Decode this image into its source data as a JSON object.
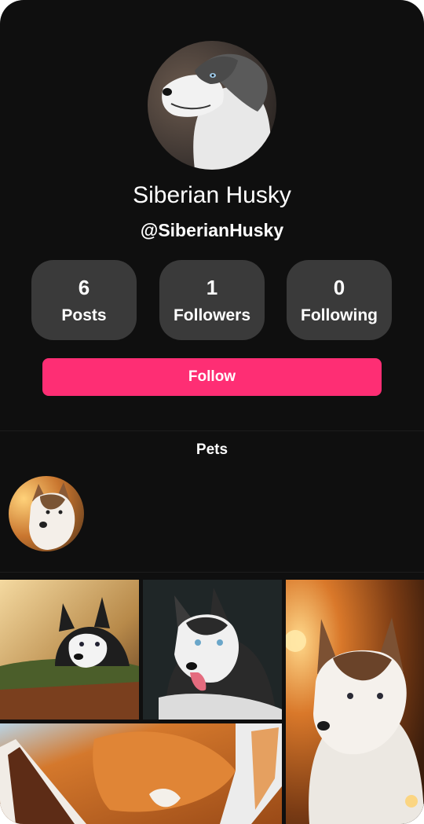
{
  "profile": {
    "name": "Siberian Husky",
    "handle": "@SiberianHusky",
    "avatar_icon": "husky-profile-photo"
  },
  "stats": [
    {
      "value": "6",
      "label": "Posts"
    },
    {
      "value": "1",
      "label": "Followers"
    },
    {
      "value": "0",
      "label": "Following"
    }
  ],
  "follow_button": {
    "label": "Follow",
    "color": "#fe2e74"
  },
  "pets_section": {
    "title": "Pets",
    "pets": [
      {
        "icon": "husky-pet-avatar"
      }
    ]
  },
  "gallery": {
    "items": [
      {
        "icon": "husky-on-log-photo"
      },
      {
        "icon": "black-white-husky-photo"
      },
      {
        "icon": "husky-sunset-photo"
      },
      {
        "icon": "fox-closeup-photo"
      }
    ]
  },
  "colors": {
    "background": "#0f0f0f",
    "card": "#3a3a3a",
    "accent": "#fe2e74"
  }
}
